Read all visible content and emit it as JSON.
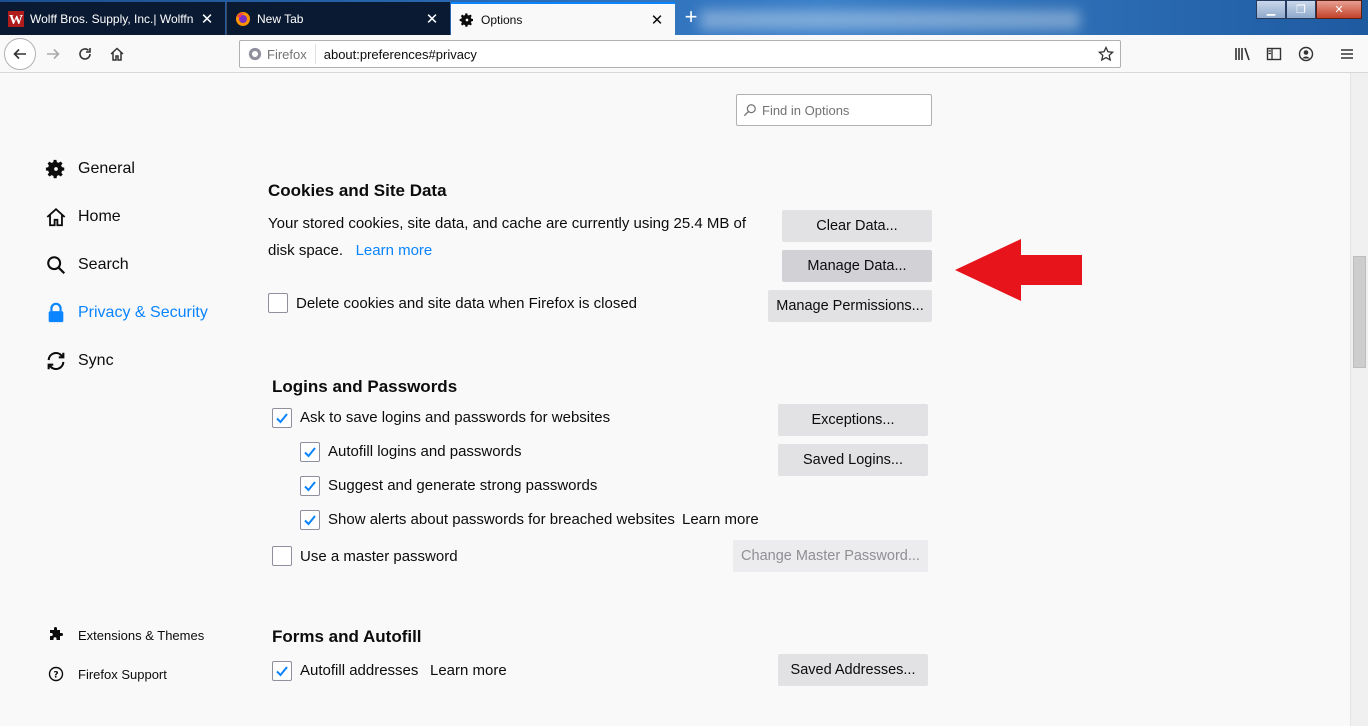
{
  "tabs": [
    {
      "title": "Wolff Bros. Supply, Inc.| Wolffn",
      "favicon": "w-logo-icon"
    },
    {
      "title": "New Tab",
      "favicon": "firefox-icon"
    },
    {
      "title": "Options",
      "favicon": "gear-icon"
    }
  ],
  "newtab_symbol": "+",
  "urlbar": {
    "identity": "Firefox",
    "url": "about:preferences#privacy"
  },
  "search": {
    "placeholder": "Find in Options"
  },
  "sidebar": {
    "items": [
      {
        "label": "General",
        "icon": "gear-icon"
      },
      {
        "label": "Home",
        "icon": "home-icon"
      },
      {
        "label": "Search",
        "icon": "search-icon"
      },
      {
        "label": "Privacy & Security",
        "icon": "lock-icon",
        "selected": true
      },
      {
        "label": "Sync",
        "icon": "sync-icon"
      }
    ],
    "footer": [
      {
        "label": "Extensions & Themes",
        "icon": "puzzle-icon"
      },
      {
        "label": "Firefox Support",
        "icon": "help-icon"
      }
    ]
  },
  "cookies": {
    "heading": "Cookies and Site Data",
    "desc_line1": "Your stored cookies, site data, and cache are currently using 25.4 MB of",
    "desc_line2": "disk space.",
    "learn_more": "Learn more",
    "delete_on_close": {
      "label": "Delete cookies and site data when Firefox is closed",
      "checked": false
    },
    "clear_data": "Clear Data...",
    "manage_data": "Manage Data...",
    "manage_permissions": "Manage Permissions..."
  },
  "logins": {
    "heading": "Logins and Passwords",
    "ask_save": {
      "label": "Ask to save logins and passwords for websites",
      "checked": true
    },
    "autofill": {
      "label": "Autofill logins and passwords",
      "checked": true
    },
    "suggest": {
      "label": "Suggest and generate strong passwords",
      "checked": true
    },
    "alerts": {
      "label": "Show alerts about passwords for breached websites",
      "checked": true
    },
    "alerts_learn_more": "Learn more",
    "master": {
      "label": "Use a master password",
      "checked": false
    },
    "exceptions": "Exceptions...",
    "saved_logins": "Saved Logins...",
    "change_master": "Change Master Password..."
  },
  "forms": {
    "heading": "Forms and Autofill",
    "autofill_addresses": {
      "label": "Autofill addresses",
      "checked": true
    },
    "learn_more": "Learn more",
    "saved_addresses": "Saved Addresses..."
  },
  "colors": {
    "accent": "#0a84ff",
    "arrow": "#e8141b"
  }
}
